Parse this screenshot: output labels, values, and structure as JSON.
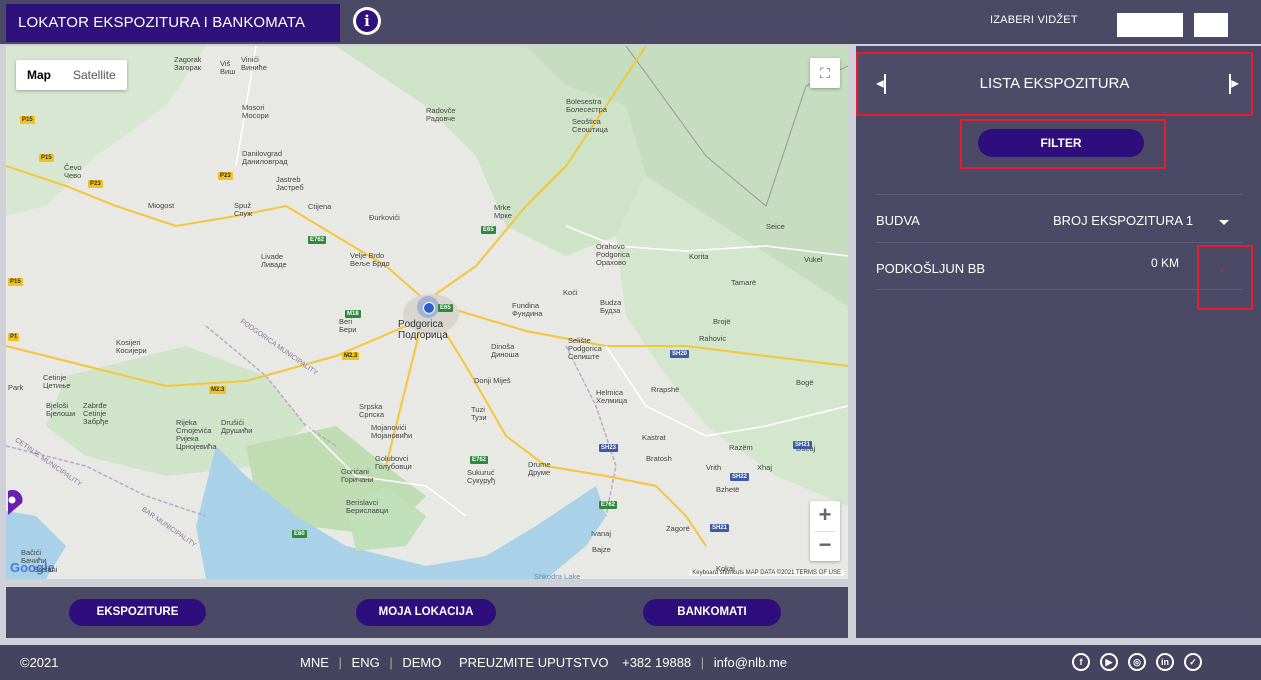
{
  "header": {
    "title": "LOKATOR EKSPOZITURA I BANKOMATA",
    "info_icon": "info-icon",
    "widget_label": "IZABERI VIDŽET"
  },
  "map": {
    "type_map": "Map",
    "type_satellite": "Satellite",
    "fullscreen_icon": "fullscreen-icon",
    "zoom_in": "+",
    "zoom_out": "−",
    "google_logo": "Google",
    "attribution": "Keyboard shortcuts   MAP DATA ©2021   TERMS OF USE",
    "place_labels": [
      "Zagorak",
      "Загорак",
      "Vinići",
      "Виниће",
      "Viš",
      "Виш",
      "Mosori",
      "Мосори",
      "Radovče",
      "Радовче",
      "Bolesestra",
      "Болесестра",
      "Seoštica",
      "Сеоштица",
      "Danilovgrad",
      "Даниловград",
      "Čevo",
      "Чево",
      "Jastreb",
      "Јастреб",
      "Miogost",
      "Spuž",
      "Спуж",
      "Ctijena",
      "Đurkovići",
      "Mrke",
      "Мрке",
      "Orahovo",
      "Podgorica",
      "Орахово",
      "Korita",
      "Seice",
      "Vukel",
      "Livade",
      "Ливаде",
      "Velje Brdo",
      "Веље Брдо",
      "Koći",
      "Fundina",
      "Фундина",
      "Budza",
      "Будза",
      "Tamarë",
      "Brojë",
      "Beri",
      "Бери",
      "Podgorica",
      "Подгорица",
      "Kosijeri",
      "Косијери",
      "Dinoša",
      "Диноша",
      "Selište",
      "Podgorica",
      "Селиште",
      "Rahovic",
      "Cetinje",
      "Цетиње",
      "Donji Miješ",
      "Helmica",
      "Хелмица",
      "Rrapshë",
      "Bogë",
      "Bjeloši",
      "Бјелоши",
      "Zabrđe",
      "Cetinje",
      "Забрђе",
      "Srpska",
      "Српска",
      "Tuzi",
      "Тузи",
      "Rijeka",
      "Crnojevića",
      "Ријека",
      "Црнојевића",
      "Drušići",
      "Друшићи",
      "Mojanovići",
      "Мојановићи",
      "Kastrat",
      "Razëm",
      "Dučaj",
      "Bratosh",
      "Vrith",
      "Xhaj",
      "Golubovci",
      "Голубовци",
      "Gorićani",
      "Горичани",
      "Sukuruć",
      "Сукуруђ",
      "Drume",
      "Друме",
      "Bzhetë",
      "Berislavci",
      "Бериславци",
      "Zagorë",
      "Ivanaj",
      "Bajze",
      "Kokaj",
      "Bačići",
      "Бачићи",
      "Stefani",
      "Park",
      "PODGORICA MUNICIPALITY",
      "CETINJE MUNICIPALITY",
      "BAR MUNICIPALITY",
      "Shkodra Lake",
      "P15",
      "P15",
      "P23",
      "P23",
      "P15",
      "P1",
      "M2.3",
      "M2.3",
      "M18",
      "E762",
      "E65",
      "E65",
      "SH20",
      "SH21",
      "SH21",
      "SH23",
      "SH22",
      "E762",
      "E762",
      "E80"
    ]
  },
  "bottom_buttons": {
    "branches": "EKSPOZITURE",
    "my_location": "MOJA LOKACIJA",
    "atms": "BANKOMATI"
  },
  "panel": {
    "title": "LISTA EKSPOZITURA",
    "filter": "FILTER",
    "city": "BUDVA",
    "branch_count": "BROJ EKSPOZITURA 1",
    "branch_name": "PODKOŠLJUN BB",
    "branch_distance": "0 KM"
  },
  "footer": {
    "copyright": "©2021",
    "lang_mne": "MNE",
    "lang_eng": "ENG",
    "demo": "DEMO",
    "download": "PREUZMITE UPUTSTVO",
    "phone": "+382 19888",
    "email": "info@nlb.me",
    "sep": "|",
    "socials": [
      "facebook-icon",
      "youtube-icon",
      "instagram-icon",
      "linkedin-icon",
      "twitter-icon"
    ]
  },
  "colors": {
    "brand_purple": "#2e0d7c",
    "panel_bg": "#4a4a66",
    "highlight_red": "#e41e2a"
  }
}
